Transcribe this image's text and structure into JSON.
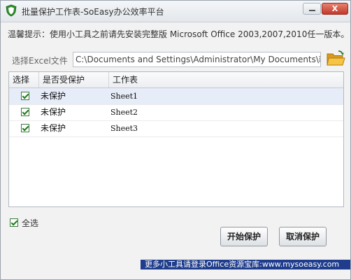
{
  "window": {
    "title": "批量保护工作表-SoEasy办公效率平台",
    "close_label": "X"
  },
  "tip": "温馨提示：使用小工具之前请先安装完整版 Microsoft Office 2003,2007,2010任一版本。",
  "file": {
    "label": "选择Excel文件",
    "path": "C:\\Documents and Settings\\Administrator\\My Documents\\新"
  },
  "grid": {
    "headers": [
      "选择",
      "是否受保护",
      "工作表"
    ],
    "rows": [
      {
        "checked": true,
        "status": "未保护",
        "sheet": "Sheet1"
      },
      {
        "checked": true,
        "status": "未保护",
        "sheet": "Sheet2"
      },
      {
        "checked": true,
        "status": "未保护",
        "sheet": "Sheet3"
      }
    ]
  },
  "select_all": {
    "label": "全选",
    "checked": true
  },
  "buttons": {
    "start": "开始保护",
    "cancel": "取消保护"
  },
  "footer": "更多小工具请登录Office资源宝库:www.mysoeasy.com",
  "colors": {
    "checkmark": "#1e7a1e",
    "footer_bg": "#1f3d8c",
    "close": "#c0392b",
    "selected_row": "#e6ecf8"
  }
}
